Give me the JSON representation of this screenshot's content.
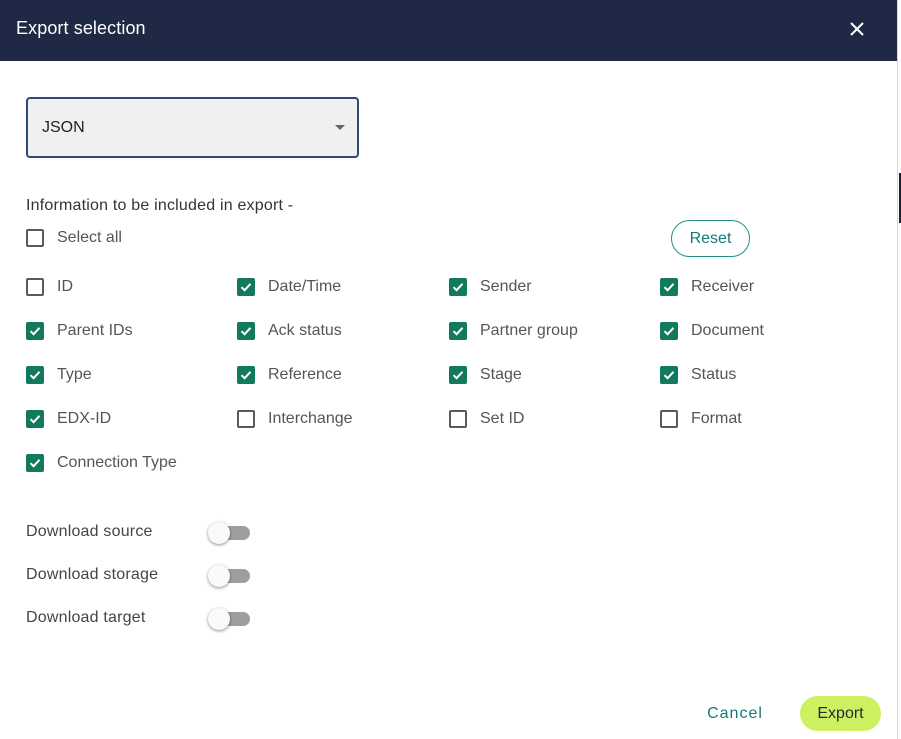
{
  "dialog": {
    "title": "Export selection",
    "close_icon": "close-icon"
  },
  "format_select": {
    "value": "JSON",
    "caret_icon": "caret-down-icon"
  },
  "info_label": "Information to be included in export -",
  "select_all": {
    "label": "Select all",
    "checked": false
  },
  "reset_label": "Reset",
  "fields": [
    {
      "label": "ID",
      "checked": false
    },
    {
      "label": "Date/Time",
      "checked": true
    },
    {
      "label": "Sender",
      "checked": true
    },
    {
      "label": "Receiver",
      "checked": true
    },
    {
      "label": "Parent IDs",
      "checked": true
    },
    {
      "label": "Ack status",
      "checked": true
    },
    {
      "label": "Partner group",
      "checked": true
    },
    {
      "label": "Document",
      "checked": true
    },
    {
      "label": "Type",
      "checked": true
    },
    {
      "label": "Reference",
      "checked": true
    },
    {
      "label": "Stage",
      "checked": true
    },
    {
      "label": "Status",
      "checked": true
    },
    {
      "label": "EDX-ID",
      "checked": true
    },
    {
      "label": "Interchange",
      "checked": false
    },
    {
      "label": "Set ID",
      "checked": false
    },
    {
      "label": "Format",
      "checked": false
    },
    {
      "label": "Connection Type",
      "checked": true
    }
  ],
  "toggles": [
    {
      "label": "Download source",
      "on": false
    },
    {
      "label": "Download storage",
      "on": false
    },
    {
      "label": "Download target",
      "on": false
    }
  ],
  "actions": {
    "cancel_label": "Cancel",
    "export_label": "Export"
  },
  "colors": {
    "header_bg": "#1f2844",
    "checkbox_checked": "#127a5c",
    "accent_teal": "#127a78",
    "export_bg": "#cdf061"
  }
}
